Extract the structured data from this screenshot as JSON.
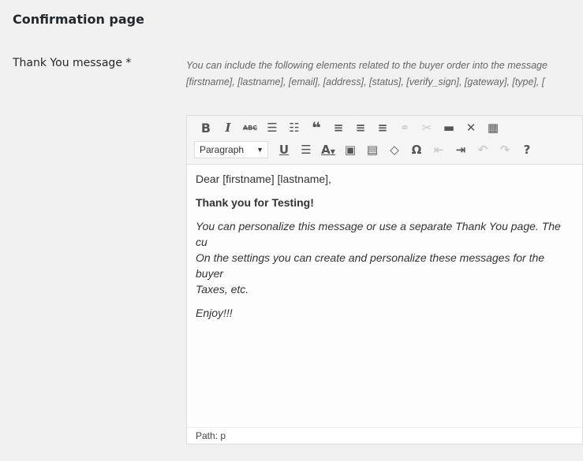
{
  "section_title": "Confirmation page",
  "field_label": "Thank You message *",
  "description": [
    "You can include the following elements related to the buyer order into the message",
    "[firstname], [lastname], [email], [address], [status], [verify_sign], [gateway], [type], ["
  ],
  "toolbar": {
    "row1": [
      "bold-icon",
      "italic-icon",
      "strikethrough-icon",
      "bullet-list-icon",
      "numbered-list-icon",
      "blockquote-icon",
      "align-left-icon",
      "align-center-icon",
      "align-right-icon",
      "link-icon",
      "unlink-icon",
      "read-more-icon",
      "fullscreen-icon",
      "toolbar-toggle-icon"
    ],
    "format_select": "Paragraph",
    "row2": [
      "underline-icon",
      "justify-icon",
      "text-color-icon",
      "paste-text-icon",
      "paste-word-icon",
      "clear-format-icon",
      "special-char-icon",
      "outdent-icon",
      "indent-icon",
      "undo-icon",
      "redo-icon",
      "help-icon"
    ]
  },
  "content": {
    "greeting": "Dear [firstname] [lastname],",
    "bold_line": "Thank you for Testing!",
    "para1": "You can personalize this message or use a separate Thank You page. The cu",
    "para2": "On the settings you can create and personalize these messages for the buyer",
    "para3": "Taxes, etc.",
    "closing": "Enjoy!!!"
  },
  "path": "Path: p"
}
